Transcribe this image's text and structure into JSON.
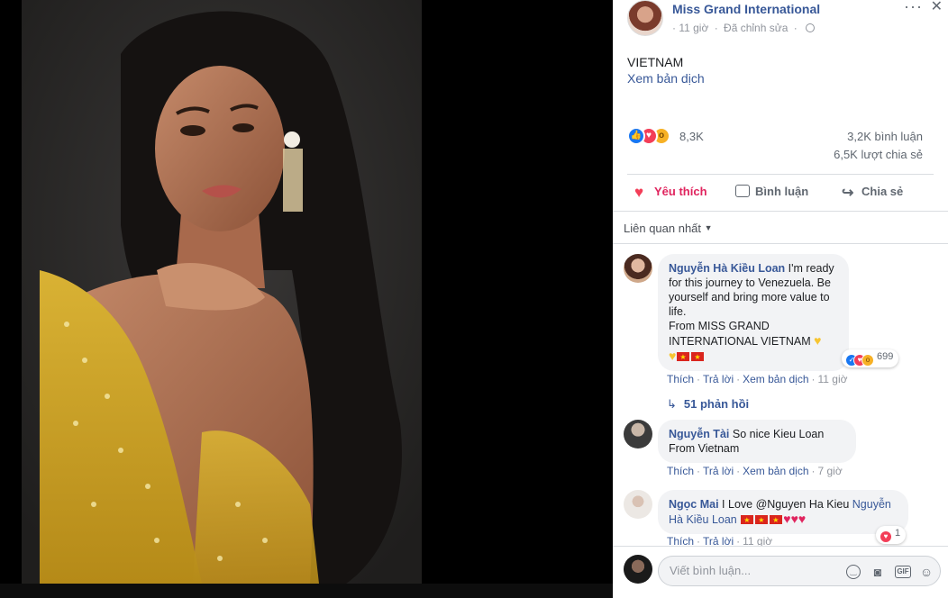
{
  "post": {
    "page_name": "Miss Grand International",
    "time": "11 giờ",
    "edited": "Đã chỉnh sửa",
    "text": "VIETNAM",
    "translate": "Xem bản dịch",
    "reaction_count": "8,3K",
    "comment_count": "3,2K bình luận",
    "share_count": "6,5K lượt chia sẻ"
  },
  "actions": {
    "like": "Yêu thích",
    "comment": "Bình luận",
    "share": "Chia sẻ"
  },
  "sort": "Liên quan nhất",
  "comments": [
    {
      "author": "Nguyễn Hà Kiều Loan",
      "text_1": "I'm ready for this journey to Venezuela. Be yourself and bring more value to life.",
      "text_2": "From MISS GRAND INTERNATIONAL VIETNAM",
      "reaction_count": "699",
      "like": "Thích",
      "reply": "Trả lời",
      "translate": "Xem bản dịch",
      "time": "11 giờ",
      "replies": "51 phản hồi"
    },
    {
      "author": "Nguyễn Tài",
      "text": "So nice Kieu Loan From Vietnam",
      "like": "Thích",
      "reply": "Trả lời",
      "translate": "Xem bản dịch",
      "time": "7 giờ"
    },
    {
      "author": "Ngọc Mai",
      "text": "I Love @Nguyen Ha Kieu",
      "mention": "Nguyễn Hà Kiều Loan",
      "reaction_count": "1",
      "like": "Thích",
      "reply": "Trả lời",
      "time": "11 giờ"
    }
  ],
  "composer": {
    "placeholder": "Viết bình luận..."
  },
  "icons": {
    "like": "like-icon",
    "love": "love-icon",
    "wow": "wow-icon",
    "globe": "globe-icon",
    "more": "more-icon",
    "close": "close-icon",
    "emoji": "emoji-icon",
    "camera": "camera-icon",
    "gif": "gif-icon",
    "sticker": "sticker-icon"
  },
  "colors": {
    "link": "#385898",
    "love_active": "#e0245e",
    "like": "#1877f2",
    "bubble": "#f2f3f5"
  }
}
